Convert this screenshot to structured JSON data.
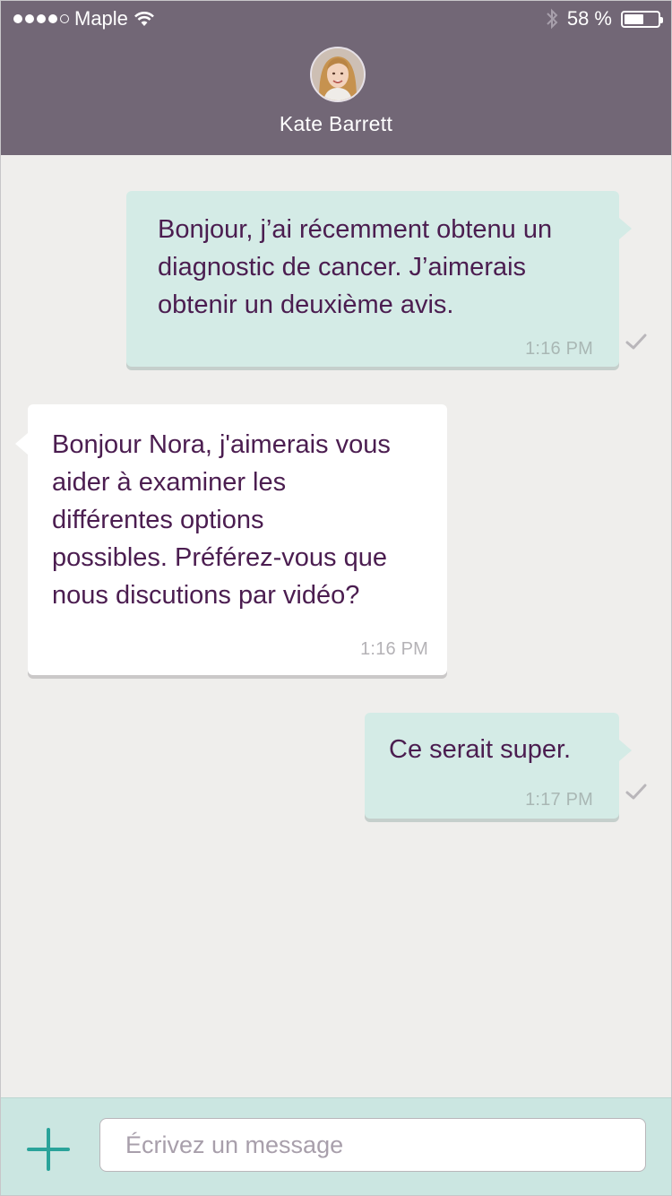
{
  "status_bar": {
    "carrier": "Maple",
    "battery_percent": "58 %",
    "battery_level": 0.58,
    "signal_bars": 4
  },
  "header": {
    "contact_name": "Kate Barrett"
  },
  "messages": [
    {
      "direction": "outgoing",
      "text": "Bonjour, j’ai récemment obtenu un\ndiagnostic de cancer. J’aimerais\nobtenir un deuxième avis.",
      "time": "1:16 PM",
      "read": true
    },
    {
      "direction": "incoming",
      "text": "Bonjour Nora, j'aimerais vous\naider à examiner les\ndifférentes options\npossibles. Préférez-vous que\nnous discutions par vidéo?",
      "time": "1:16 PM"
    },
    {
      "direction": "outgoing",
      "text": "Ce serait super.",
      "time": "1:17 PM",
      "read": true
    }
  ],
  "composer": {
    "placeholder": "Écrivez un message",
    "value": ""
  },
  "colors": {
    "header": "#726776",
    "background": "#efeeec",
    "outgoing_bubble": "#d4ebe6",
    "incoming_bubble": "#ffffff",
    "text": "#4b1d50",
    "accent": "#2aa39a"
  }
}
